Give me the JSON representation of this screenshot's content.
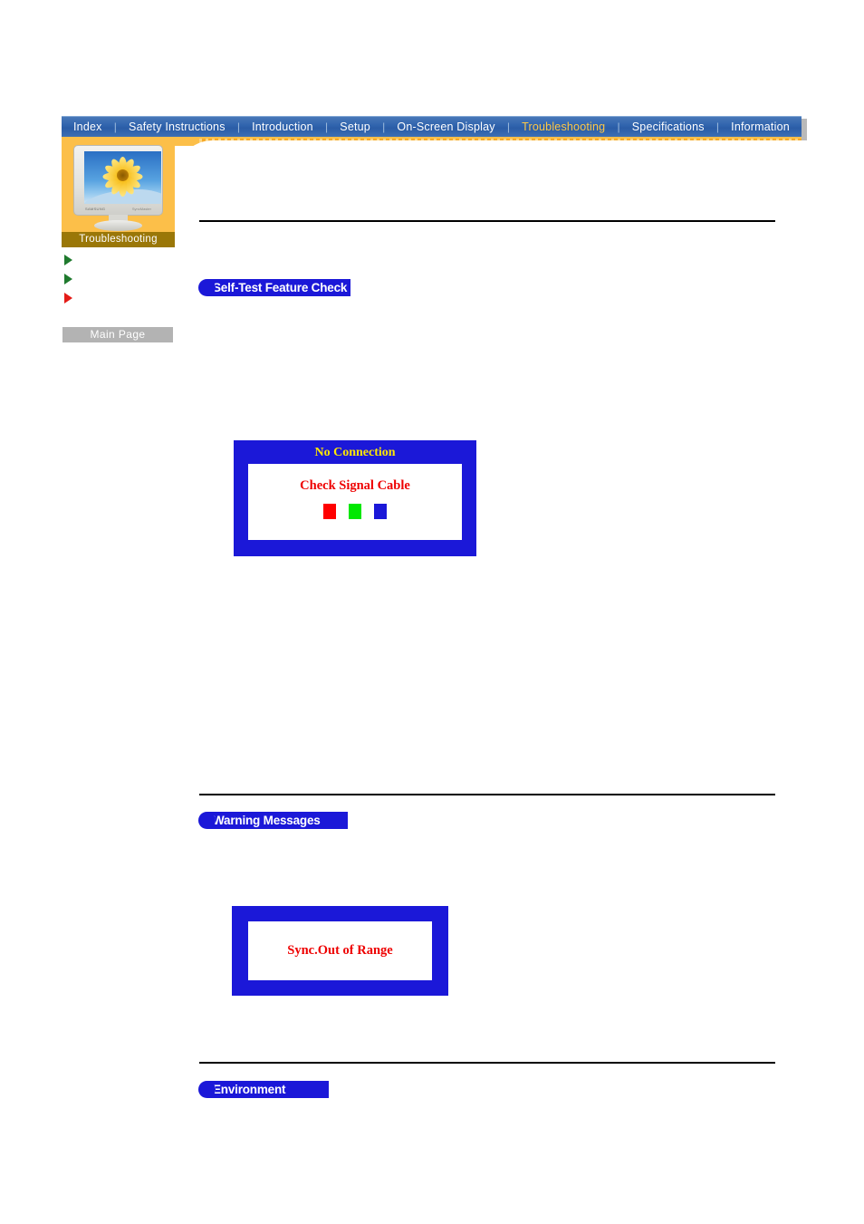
{
  "nav": {
    "items": [
      {
        "label": "Index",
        "active": false
      },
      {
        "label": "Safety Instructions",
        "active": false
      },
      {
        "label": "Introduction",
        "active": false
      },
      {
        "label": "Setup",
        "active": false
      },
      {
        "label": "On-Screen Display",
        "active": false
      },
      {
        "label": "Troubleshooting",
        "active": true
      },
      {
        "label": "Specifications",
        "active": false
      },
      {
        "label": "Information",
        "active": false
      }
    ],
    "separator": "|",
    "active_color": "#ffc845",
    "bar_color": "#2f63ad"
  },
  "sidebar": {
    "thumbnail_caption": "Troubleshooting",
    "monitor_brand": "SAMSUNG",
    "monitor_model": "SyncMaster",
    "links": [
      {
        "icon": "green-arrow-icon",
        "color": "#1f7a2e",
        "label": ""
      },
      {
        "icon": "green-arrow-icon",
        "color": "#1f7a2e",
        "label": ""
      },
      {
        "icon": "red-arrow-icon",
        "color": "#e41b17",
        "label": ""
      }
    ],
    "main_page_button": "Main Page"
  },
  "sections": [
    {
      "id": "self-test",
      "title": "Self-Test Feature Check"
    },
    {
      "id": "warning-messages",
      "title": "Warning Messages"
    },
    {
      "id": "environment",
      "title": "Environment"
    }
  ],
  "osd_no_connection": {
    "title": "No Connection",
    "message": "Check Signal Cable",
    "title_color": "#ffe800",
    "message_color": "#ee0000",
    "frame_color": "#1b18d8",
    "swatches": [
      {
        "name": "red-swatch",
        "color": "#ff0000"
      },
      {
        "name": "green-swatch",
        "color": "#00e800"
      },
      {
        "name": "blue-swatch",
        "color": "#1b18d8"
      }
    ]
  },
  "osd_sync_out_of_range": {
    "message": "Sync.Out of Range",
    "message_color": "#ee0000",
    "frame_color": "#1b18d8"
  }
}
